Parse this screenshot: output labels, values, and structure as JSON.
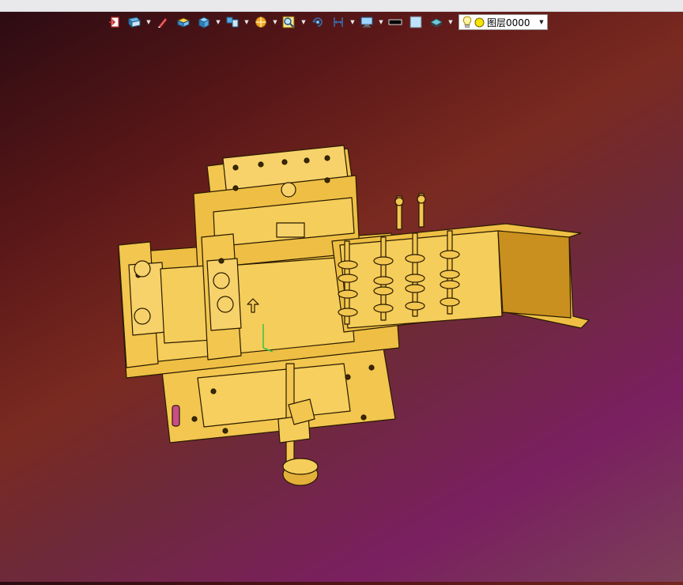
{
  "toolbar": {
    "icons": [
      {
        "name": "exit-icon"
      },
      {
        "name": "view-orientation-icon"
      },
      {
        "name": "sketch-pen-icon"
      },
      {
        "name": "solid-shape-icon"
      },
      {
        "name": "cube-view-icon"
      },
      {
        "name": "multi-view-icon"
      },
      {
        "name": "render-style-icon"
      },
      {
        "name": "zoom-fit-icon"
      },
      {
        "name": "rotate-view-icon"
      },
      {
        "name": "dimension-icon"
      },
      {
        "name": "display-settings-icon"
      }
    ],
    "line_color": "#000000",
    "fill_color": "#bfe3ff",
    "layer": {
      "value": "图层0000",
      "bulb_color": "#ffe14d",
      "dot_color": "#f5e400"
    }
  },
  "viewport": {
    "model_color": "#f2c64f",
    "outline_color": "#2a1a00"
  }
}
